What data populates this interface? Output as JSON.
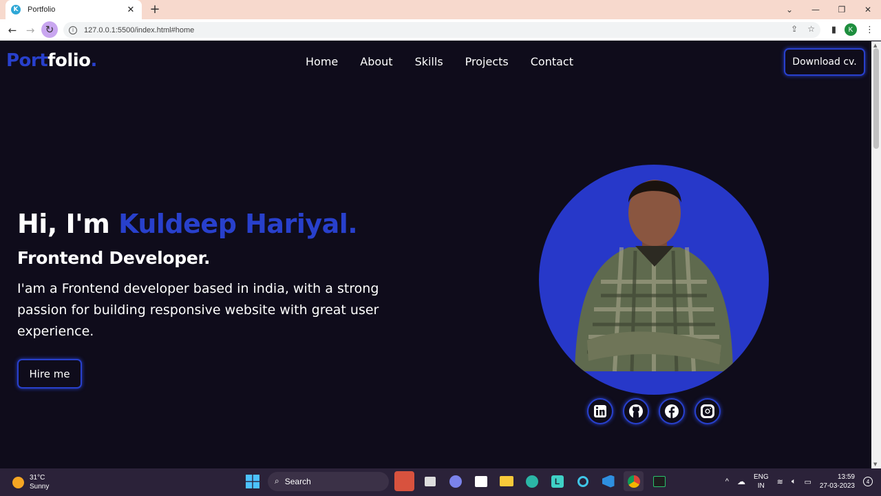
{
  "browser": {
    "tab_title": "Portfolio",
    "favicon_letter": "K",
    "url": "127.0.0.1:5500/index.html#home",
    "profile_initial": "K"
  },
  "site": {
    "logo_part1": "Port",
    "logo_part2": "folio",
    "logo_dot": ".",
    "nav": [
      "Home",
      "About",
      "Skills",
      "Projects",
      "Contact"
    ],
    "download_label": "Download cv.",
    "greeting": "Hi, I'm ",
    "name": "Kuldeep Hariyal.",
    "role": "Frontend Developer.",
    "description": "I'am a Frontend developer based in india, with a strong passion for building responsive website with great user experience.",
    "hire_label": "Hire me",
    "socials": [
      "linkedin-icon",
      "github-icon",
      "facebook-icon",
      "instagram-icon"
    ],
    "colors": {
      "accent": "#2840cc",
      "background": "#0f0c1b"
    }
  },
  "taskbar": {
    "temperature": "31°C",
    "condition": "Sunny",
    "search_label": "Search",
    "lang_line1": "ENG",
    "lang_line2": "IN",
    "time": "13:59",
    "date": "27-03-2023",
    "notif_count": "4"
  }
}
